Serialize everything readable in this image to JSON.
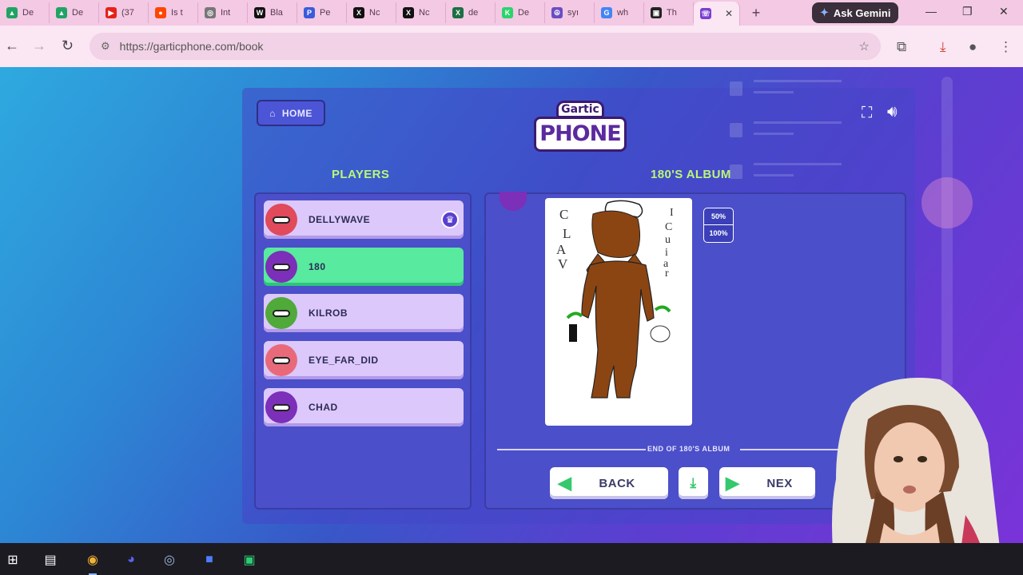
{
  "browser": {
    "tabs": [
      {
        "label": "De",
        "icon": "google-drive-icon",
        "color": "#1fa463",
        "glyph": "▲"
      },
      {
        "label": "De",
        "icon": "google-drive-icon",
        "color": "#1fa463",
        "glyph": "▲"
      },
      {
        "label": "(37",
        "icon": "youtube-icon",
        "color": "#e62117",
        "glyph": "▶"
      },
      {
        "label": "Is t",
        "icon": "reddit-icon",
        "color": "#ff4500",
        "glyph": "●"
      },
      {
        "label": "Int",
        "icon": "globe-icon",
        "color": "#777777",
        "glyph": "◎"
      },
      {
        "label": "Bla",
        "icon": "wix-icon",
        "color": "#111111",
        "glyph": "W"
      },
      {
        "label": "Pe",
        "icon": "pdf-icon",
        "color": "#3b5bdb",
        "glyph": "P"
      },
      {
        "label": "Nc",
        "icon": "x-icon",
        "color": "#111111",
        "glyph": "X"
      },
      {
        "label": "Nc",
        "icon": "x-icon",
        "color": "#111111",
        "glyph": "X"
      },
      {
        "label": "de",
        "icon": "excel-icon",
        "color": "#1d6f42",
        "glyph": "X"
      },
      {
        "label": "De",
        "icon": "k-icon",
        "color": "#2bd46a",
        "glyph": "K"
      },
      {
        "label": "syı",
        "icon": "peace-icon",
        "color": "#6a4cc2",
        "glyph": "☮"
      },
      {
        "label": "wh",
        "icon": "google-icon",
        "color": "#4285f4",
        "glyph": "G"
      },
      {
        "label": "Th",
        "icon": "terminal-icon",
        "color": "#222222",
        "glyph": "▣"
      },
      {
        "label": "",
        "icon": "garticphone-icon",
        "color": "#7b3fd0",
        "glyph": "☏",
        "active": true
      }
    ],
    "new_tab": "+",
    "gemini_label": "Ask Gemini",
    "url": "https://garticphone.com/book"
  },
  "game": {
    "home_label": "HOME",
    "logo_top": "Gartic",
    "logo_main": "PHONE",
    "players_heading": "PLAYERS",
    "album_heading": "180'S ALBUM",
    "players": [
      {
        "name": "DELLYWAVE",
        "color": "#e04a5a",
        "host": true
      },
      {
        "name": "180",
        "color": "#7c2fb8",
        "current": true
      },
      {
        "name": "KILROB",
        "color": "#4faa3a"
      },
      {
        "name": "EYE_FAR_DID",
        "color": "#e86a7a"
      },
      {
        "name": "CHAD",
        "color": "#7c2fb8"
      }
    ],
    "zoom_options": [
      "50%",
      "100%"
    ],
    "end_text": "END OF 180'S ALBUM",
    "back_label": "BACK",
    "next_label": "NEX",
    "drawing_letters": {
      "left": [
        "C",
        "L",
        "A",
        "V"
      ],
      "right": [
        "I",
        "C",
        "u",
        "i",
        "a",
        "r"
      ]
    }
  },
  "colors": {
    "accent_green": "#b9f779",
    "current_player": "#58ea9f",
    "player_card": "#dcc8fb"
  }
}
